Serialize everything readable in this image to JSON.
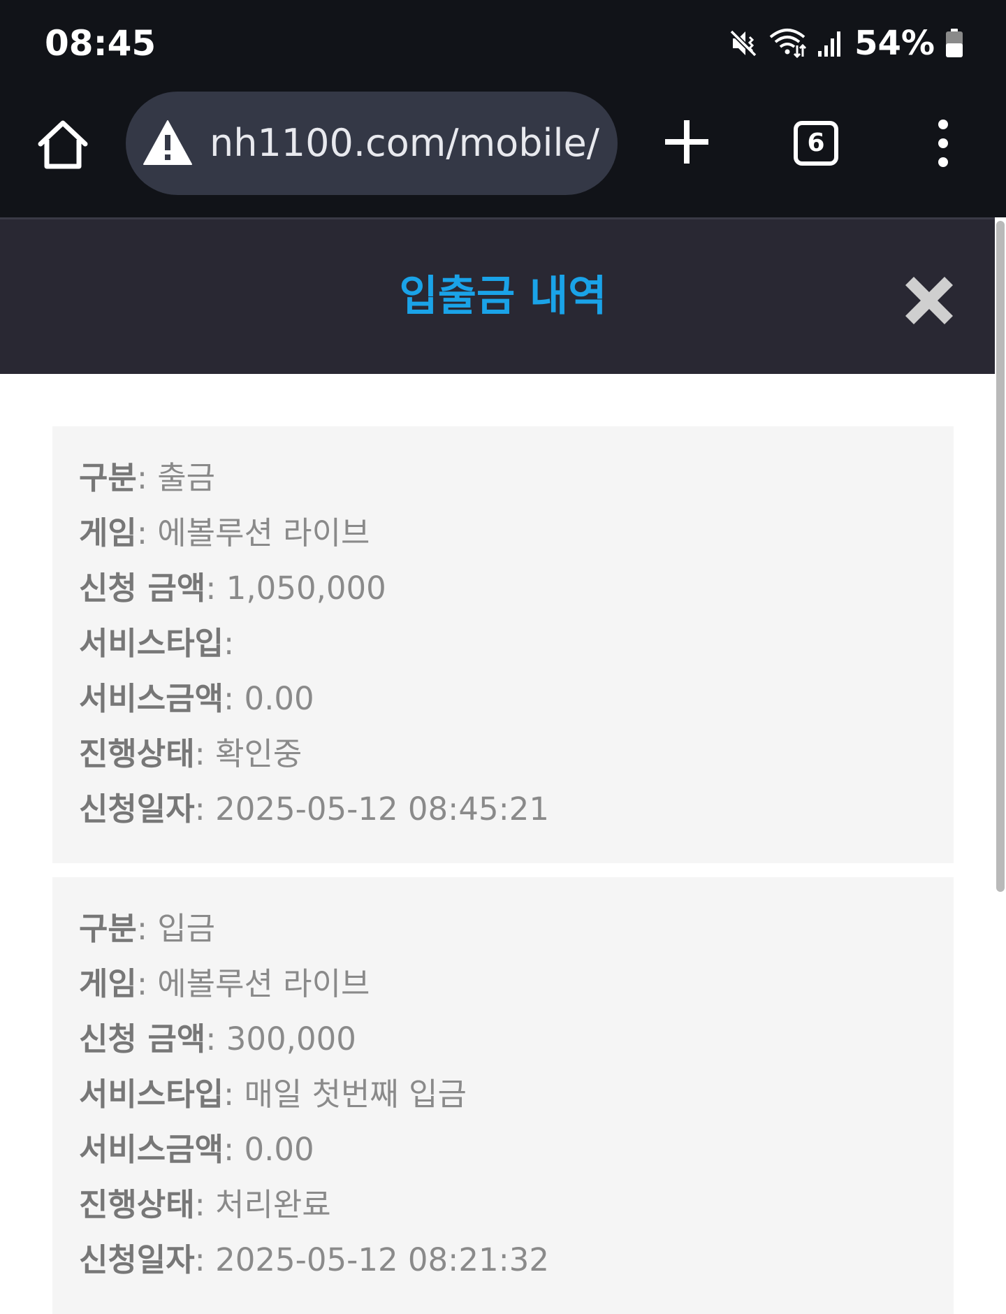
{
  "status_bar": {
    "time": "08:45",
    "battery_percent": "54%",
    "icons": [
      "vibrate-off-icon",
      "wifi-icon",
      "signal-icon",
      "battery-icon"
    ]
  },
  "browser": {
    "url": "nh1100.com/mobile/#",
    "tab_count": "6",
    "icons": [
      "home-icon",
      "warning-icon",
      "plus-icon",
      "tabs-icon",
      "more-vertical-icon"
    ]
  },
  "modal": {
    "title": "입출금 내역",
    "close_icon": "close-icon",
    "title_color": "#1aa3e8",
    "header_bg": "#292833"
  },
  "records": [
    {
      "type_label": "구분",
      "type": "출금",
      "game_label": "게임",
      "game": "에볼루션 라이브",
      "amount_label": "신청 금액",
      "amount": "1,050,000",
      "service_type_label": "서비스타입",
      "service_type": "",
      "service_amount_label": "서비스금액",
      "service_amount": "0.00",
      "status_label": "진행상태",
      "status": "확인중",
      "date_label": "신청일자",
      "date": "2025-05-12 08:45:21"
    },
    {
      "type_label": "구분",
      "type": "입금",
      "game_label": "게임",
      "game": "에볼루션 라이브",
      "amount_label": "신청 금액",
      "amount": "300,000",
      "service_type_label": "서비스타입",
      "service_type": "매일 첫번째 입금",
      "service_amount_label": "서비스금액",
      "service_amount": "0.00",
      "status_label": "진행상태",
      "status": "처리완료",
      "date_label": "신청일자",
      "date": "2025-05-12 08:21:32"
    }
  ]
}
